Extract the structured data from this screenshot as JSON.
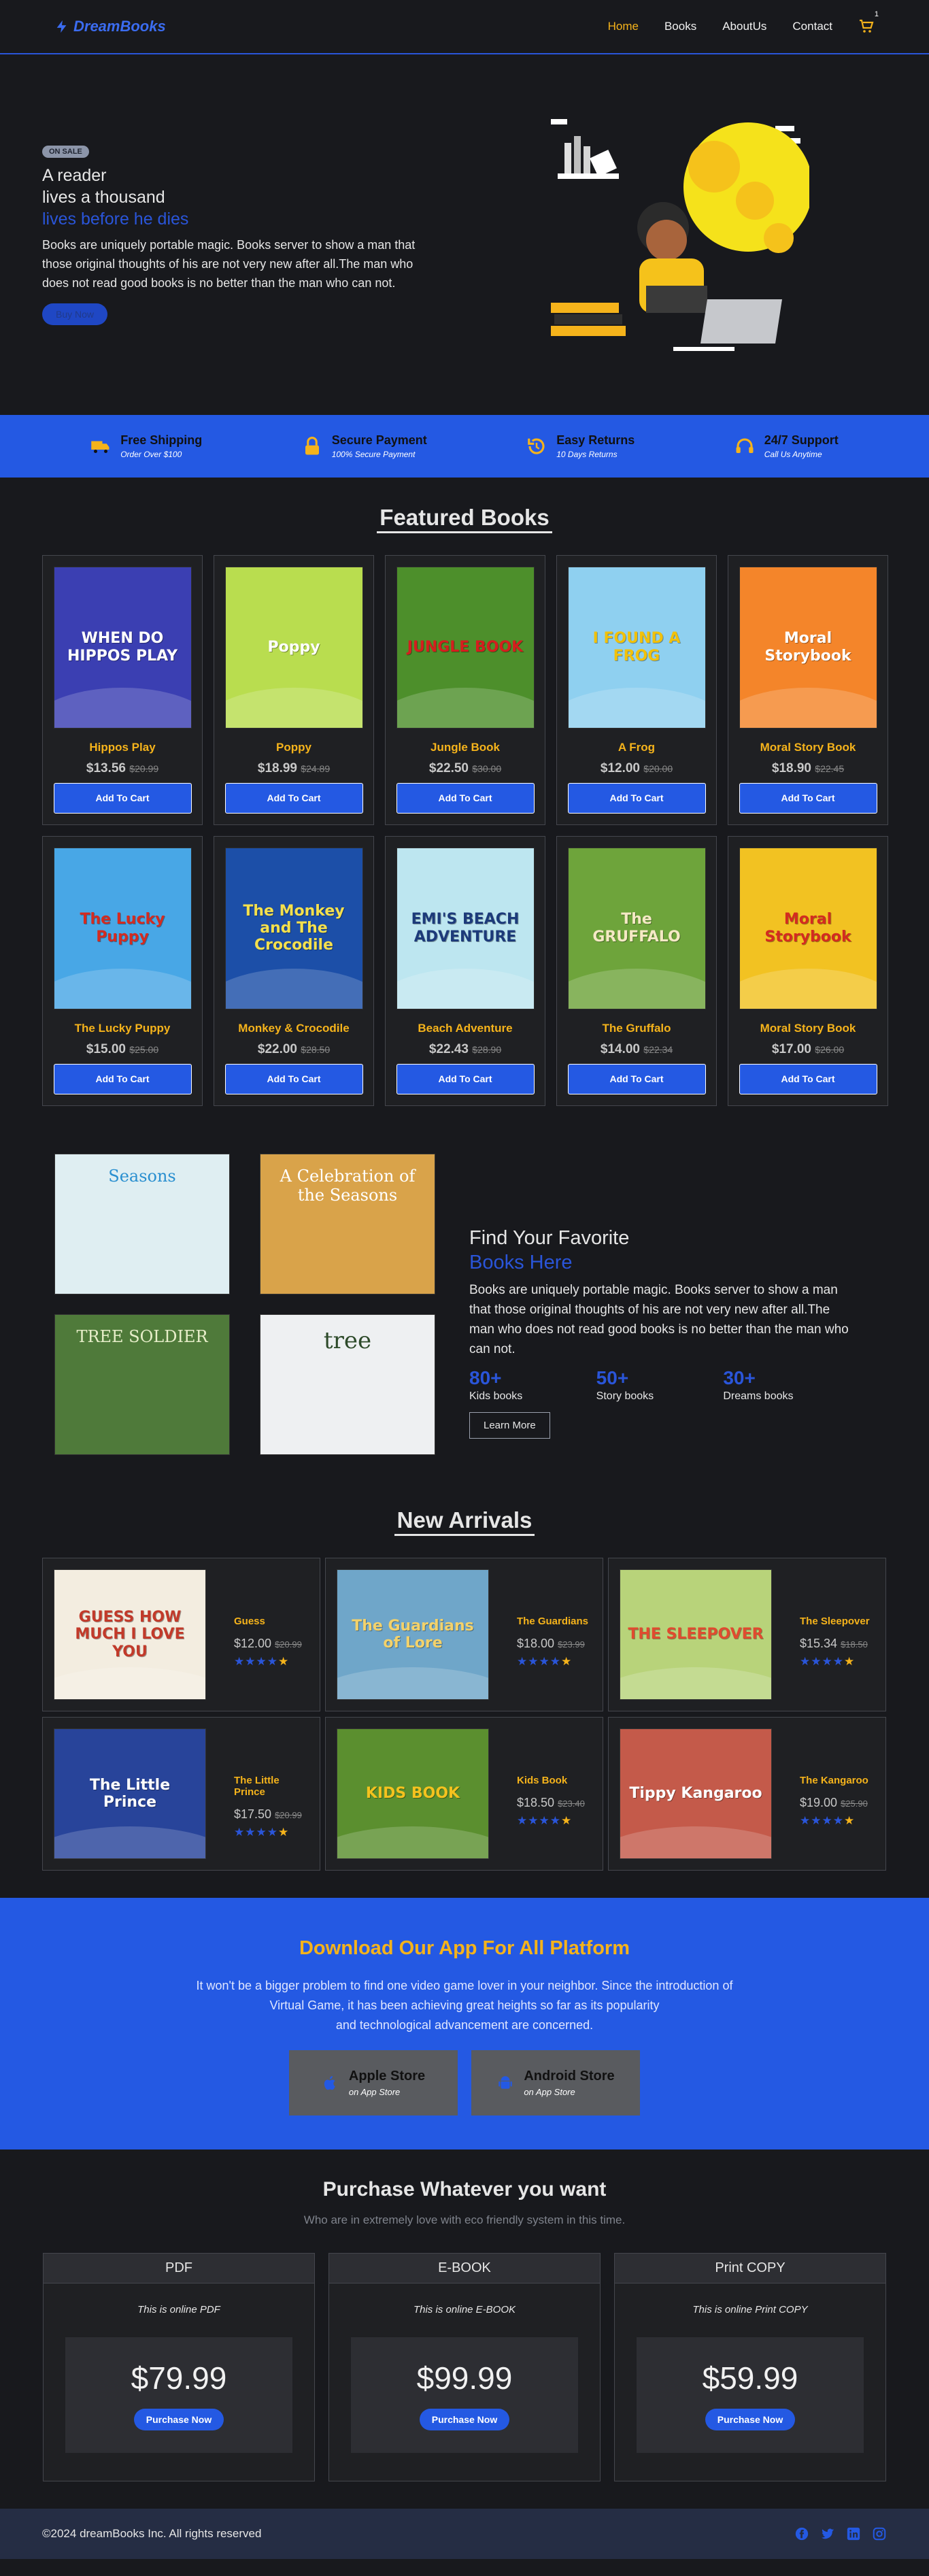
{
  "nav": {
    "brand": "DreamBooks",
    "items": [
      {
        "label": "Home",
        "active": true
      },
      {
        "label": "Books",
        "active": false
      },
      {
        "label": "AboutUs",
        "active": false
      },
      {
        "label": "Contact",
        "active": false
      }
    ],
    "cart_count": "1"
  },
  "hero": {
    "badge": "ON SALE",
    "line1": "A reader",
    "line2": "lives a thousand",
    "line3": "lives before he dies",
    "body": "Books are uniquely portable magic. Books server to show a man that those original thoughts of his are not very new after all.The man who does not read good books is no better than the man who can not.",
    "button": "Buy Now"
  },
  "features": [
    {
      "title": "Free Shipping",
      "sub": "Order Over $100",
      "icon": "truck-icon"
    },
    {
      "title": "Secure Payment",
      "sub": "100% Secure Payment",
      "icon": "lock-icon"
    },
    {
      "title": "Easy Returns",
      "sub": "10 Days Returns",
      "icon": "return-icon"
    },
    {
      "title": "24/7 Support",
      "sub": "Call Us Anytime",
      "icon": "headset-icon"
    }
  ],
  "featured": {
    "title": "Featured Books",
    "button": "Add To Cart",
    "books": [
      {
        "name": "Hippos Play",
        "price": "$13.56",
        "old": "$20.99",
        "cover_title": "WHEN DO HIPPOS PLAY",
        "bg": "#3b3fb2",
        "fg": "#ffffff"
      },
      {
        "name": "Poppy",
        "price": "$18.99",
        "old": "$24.89",
        "cover_title": "Poppy",
        "bg": "#b9dd4f",
        "fg": "#ffffff"
      },
      {
        "name": "Jungle Book",
        "price": "$22.50",
        "old": "$30.00",
        "cover_title": "JUNGLE BOOK",
        "bg": "#4d8f2b",
        "fg": "#d51e1e"
      },
      {
        "name": "A Frog",
        "price": "$12.00",
        "old": "$20.00",
        "cover_title": "I FOUND A FROG",
        "bg": "#8fd0f0",
        "fg": "#f2c10a"
      },
      {
        "name": "Moral Story Book",
        "price": "$18.90",
        "old": "$22.45",
        "cover_title": "Moral Storybook",
        "bg": "#f4852a",
        "fg": "#ffffff"
      },
      {
        "name": "The Lucky Puppy",
        "price": "$15.00",
        "old": "$25.00",
        "cover_title": "The Lucky Puppy",
        "bg": "#48a7e6",
        "fg": "#d42b20"
      },
      {
        "name": "Monkey & Crocodile",
        "price": "$22.00",
        "old": "$28.50",
        "cover_title": "The Monkey and The Crocodile",
        "bg": "#1c4fa8",
        "fg": "#f4e04d"
      },
      {
        "name": "Beach Adventure",
        "price": "$22.43",
        "old": "$28.90",
        "cover_title": "EMI'S BEACH ADVENTURE",
        "bg": "#bde6f0",
        "fg": "#1c3a7a"
      },
      {
        "name": "The Gruffalo",
        "price": "$14.00",
        "old": "$22.34",
        "cover_title": "The GRUFFALO",
        "bg": "#6ea43b",
        "fg": "#f5e9c5"
      },
      {
        "name": "Moral Story Book",
        "price": "$17.00",
        "old": "$26.00",
        "cover_title": "Moral Storybook",
        "bg": "#f2c222",
        "fg": "#d42b20"
      }
    ]
  },
  "find": {
    "heading1": "Find Your Favorite",
    "heading2": "Books Here",
    "body": "Books are uniquely portable magic. Books server to show a man that those original thoughts of his are not very new after all.The man who does not read good books is no better than the man who can not.",
    "stats": [
      {
        "num": "80+",
        "label": "Kids books"
      },
      {
        "num": "50+",
        "label": "Story books"
      },
      {
        "num": "30+",
        "label": "Dreams books"
      }
    ],
    "button": "Learn More",
    "covers": [
      {
        "title": "Seasons",
        "bg": "#dfeef2",
        "fg": "#2a8fd0"
      },
      {
        "title": "A Celebration of the Seasons",
        "bg": "#d9a34a",
        "fg": "#ffffff"
      },
      {
        "title": "TREE SOLDIER",
        "bg": "#4f7a3a",
        "fg": "#e7eec9"
      },
      {
        "title": "tree",
        "bg": "#eef0f2",
        "fg": "#2d4a2a"
      }
    ]
  },
  "arrivals": {
    "title": "New Arrivals",
    "books": [
      {
        "name": "Guess",
        "price": "$12.00",
        "old": "$20.99",
        "cover_title": "GUESS HOW MUCH I LOVE YOU",
        "bg": "#f3ede0",
        "fg": "#c23a2a"
      },
      {
        "name": "The Guardians",
        "price": "$18.00",
        "old": "$23.99",
        "cover_title": "The Guardians of Lore",
        "bg": "#6fa6c9",
        "fg": "#f4d26a"
      },
      {
        "name": "The Sleepover",
        "price": "$15.34",
        "old": "$18.50",
        "cover_title": "THE SLEEPOVER",
        "bg": "#b8d37a",
        "fg": "#e04b2f"
      },
      {
        "name": "The Little Prince",
        "price": "$17.50",
        "old": "$20.99",
        "cover_title": "The Little Prince",
        "bg": "#28449a",
        "fg": "#ffffff"
      },
      {
        "name": "Kids Book",
        "price": "$18.50",
        "old": "$23.40",
        "cover_title": "KIDS BOOK",
        "bg": "#5b8f2f",
        "fg": "#f4c21e"
      },
      {
        "name": "The Kangaroo",
        "price": "$19.00",
        "old": "$25.90",
        "cover_title": "Tippy Kangaroo",
        "bg": "#c45a4a",
        "fg": "#ffffff"
      }
    ]
  },
  "app": {
    "title": "Download Our App For All Platform",
    "body1": "It won't be a bigger problem to find one video game lover in your neighbor. Since the introduction of",
    "body2": "Virtual Game, it has been achieving great heights so far as its popularity",
    "body3": "and technological advancement are concerned.",
    "stores": [
      {
        "title": "Apple Store",
        "sub": "on App Store",
        "icon": "apple-icon"
      },
      {
        "title": "Android Store",
        "sub": "on App Store",
        "icon": "android-icon"
      }
    ]
  },
  "purchase": {
    "title": "Purchase Whatever you want",
    "sub": "Who are in extremely love with eco friendly system in this time.",
    "button": "Purchase Now",
    "plans": [
      {
        "name": "PDF",
        "desc": "This is online PDF",
        "price": "$79.99"
      },
      {
        "name": "E-BOOK",
        "desc": "This is online E-BOOK",
        "price": "$99.99"
      },
      {
        "name": "Print COPY",
        "desc": "This is online Print COPY",
        "price": "$59.99"
      }
    ]
  },
  "footer": {
    "copy": "©2024 dreamBooks Inc. All rights reserved",
    "social": [
      "facebook-icon",
      "twitter-icon",
      "linkedin-icon",
      "instagram-icon"
    ]
  },
  "colors": {
    "bg": "#18191d",
    "accent": "#2459e3",
    "gold": "#f5b31b"
  }
}
